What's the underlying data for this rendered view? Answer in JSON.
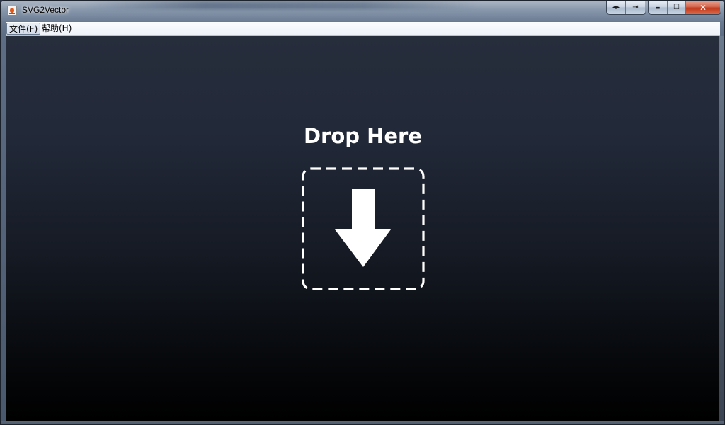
{
  "window": {
    "title": "SVG2Vector"
  },
  "titlebar_buttons": {
    "group1": [
      {
        "name": "swap-icon",
        "glyph": "◂▸"
      },
      {
        "name": "export-icon",
        "glyph": "⇥"
      }
    ],
    "group2": [
      {
        "name": "minimize-icon",
        "glyph": "▬"
      },
      {
        "name": "maximize-icon",
        "glyph": "☐"
      },
      {
        "name": "close-icon",
        "glyph": "✕"
      }
    ]
  },
  "menu": {
    "items": [
      {
        "label": "文件(F)"
      },
      {
        "label": "帮助(H)"
      }
    ]
  },
  "main": {
    "drop_label": "Drop Here",
    "drop_icon": "arrow-down-icon"
  },
  "colors": {
    "background_top": "#262d3b",
    "background_bottom": "#000000",
    "foreground": "#ffffff"
  }
}
